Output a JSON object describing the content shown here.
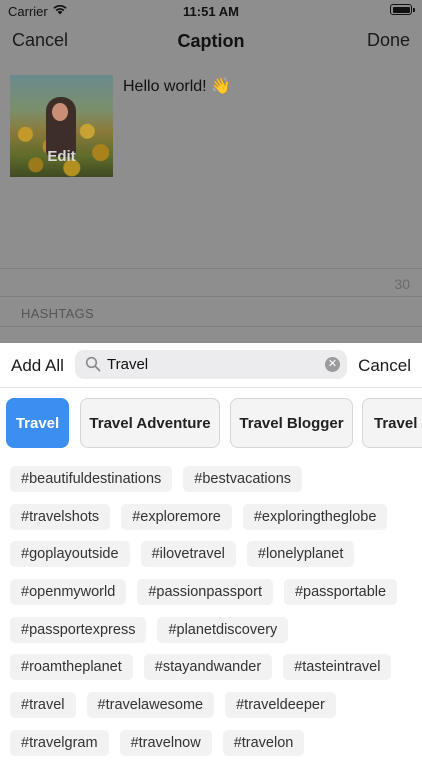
{
  "status_bar": {
    "carrier": "Carrier",
    "time": "11:51 AM"
  },
  "nav": {
    "cancel": "Cancel",
    "title": "Caption",
    "done": "Done"
  },
  "post": {
    "edit_label": "Edit",
    "caption": "Hello world! 👋"
  },
  "counter": "30",
  "hashtags_label": "HASHTAGS",
  "search": {
    "add_all": "Add All",
    "query": "Travel",
    "cancel": "Cancel"
  },
  "categories": [
    {
      "label": "Travel",
      "active": true
    },
    {
      "label": "Travel Adventure",
      "active": false
    },
    {
      "label": "Travel Blogger",
      "active": false
    },
    {
      "label": "Travel G",
      "active": false
    }
  ],
  "hashtag_rows": [
    [
      "#beautifuldestinations",
      "#bestvacations"
    ],
    [
      "#travelshots",
      "#exploremore",
      "#exploringtheglobe"
    ],
    [
      "#goplayoutside",
      "#ilovetravel",
      "#lonelyplanet"
    ],
    [
      "#openmyworld",
      "#passionpassport",
      "#passportable"
    ],
    [
      "#passportexpress",
      "#planetdiscovery"
    ],
    [
      "#roamtheplanet",
      "#stayandwander",
      "#tasteintravel"
    ],
    [
      "#travel",
      "#travelawesome",
      "#traveldeeper"
    ],
    [
      "#travelgram",
      "#travelnow",
      "#travelon"
    ]
  ],
  "colors": {
    "accent": "#3a8ff0",
    "dim_overlay": "#8e8e8e"
  },
  "icons": {
    "wifi": "wifi-icon",
    "battery": "battery-icon",
    "search": "search-icon",
    "clear": "clear-icon"
  }
}
